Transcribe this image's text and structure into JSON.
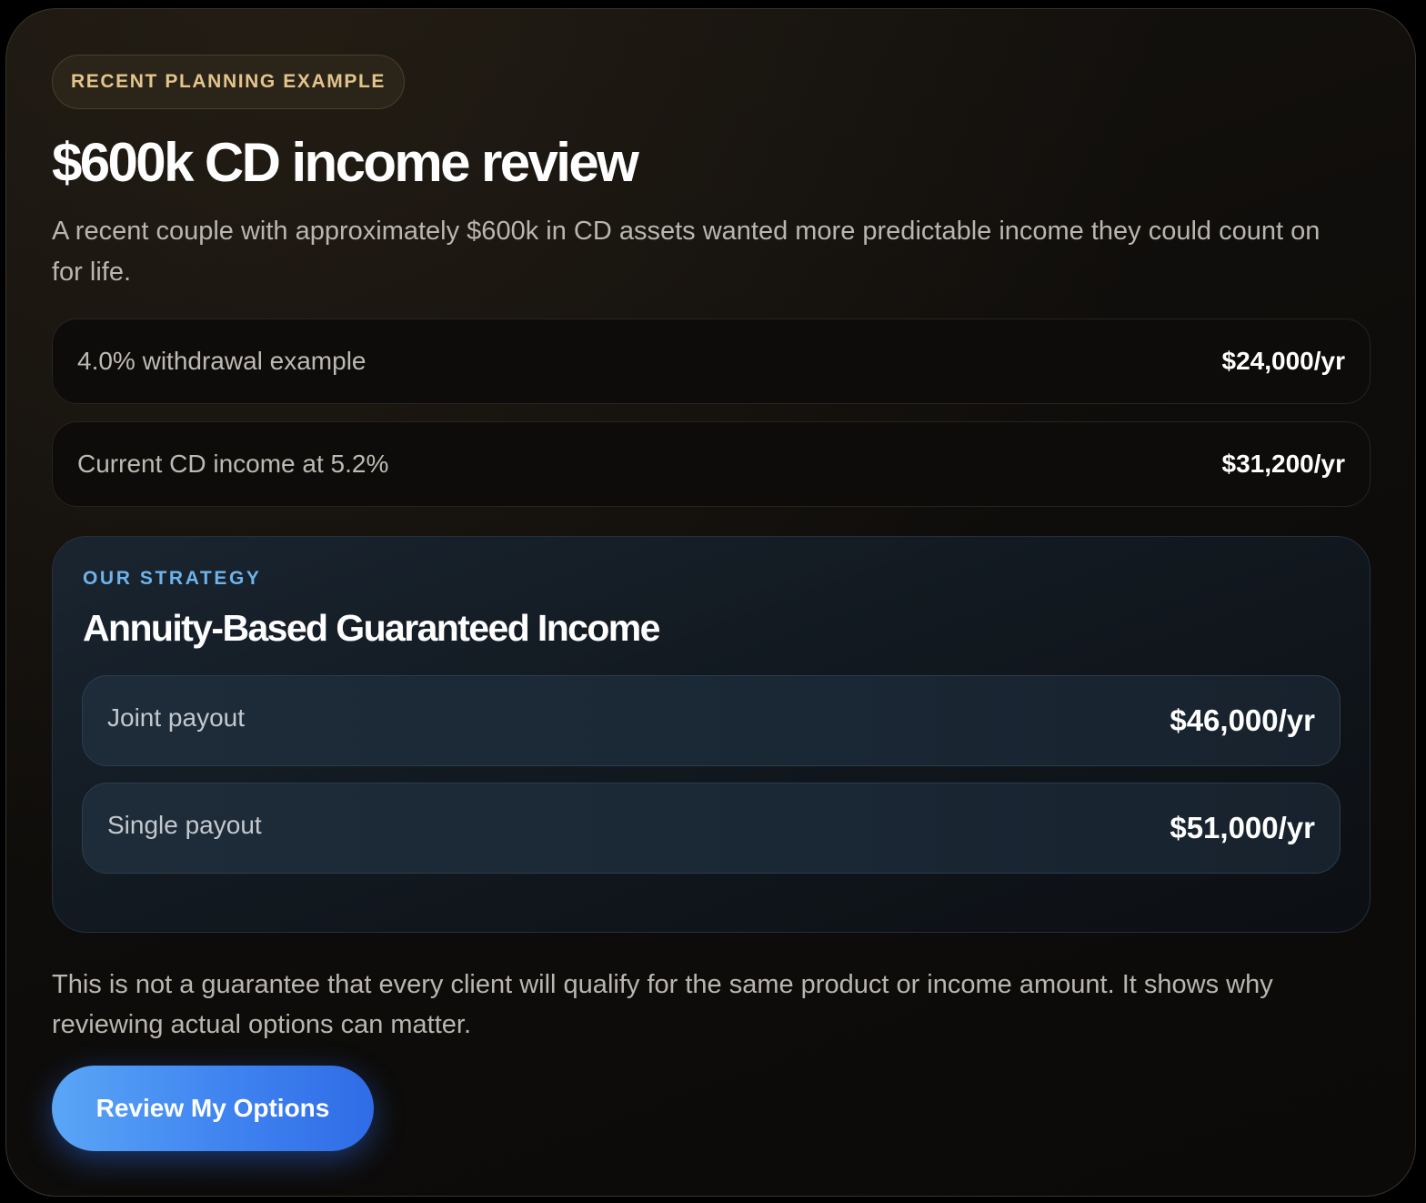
{
  "badge": "RECENT PLANNING EXAMPLE",
  "title": "$600k CD income review",
  "description": "A recent couple with approximately $600k in CD assets wanted more predictable income they could count on for life.",
  "comparisons": [
    {
      "label": "4.0% withdrawal example",
      "value": "$24,000/yr"
    },
    {
      "label": "Current CD income at 5.2%",
      "value": "$31,200/yr"
    }
  ],
  "strategy": {
    "eyebrow": "OUR STRATEGY",
    "title": "Annuity-Based Guaranteed Income",
    "payouts": [
      {
        "label": "Joint payout",
        "value": "$46,000/yr"
      },
      {
        "label": "Single payout",
        "value": "$51,000/yr"
      }
    ]
  },
  "disclaimer": "This is not a guarantee that every client will qualify for the same product or income amount. It shows why reviewing actual options can matter.",
  "cta_label": "Review My Options",
  "colors": {
    "badge_text": "#e3c48d",
    "strategy_eyebrow": "#6fb3ec",
    "cta_start": "#5aa6f6",
    "cta_end": "#2f6ce6"
  }
}
